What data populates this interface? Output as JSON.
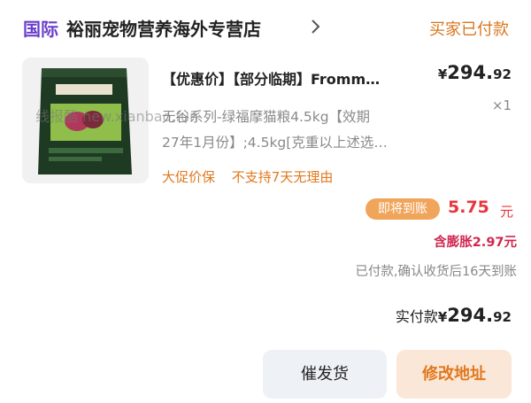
{
  "shop": {
    "tag": "国际",
    "name": "裕丽宠物营养海外专营店",
    "chevron_icon": "chevron-right-icon"
  },
  "order": {
    "status": "买家已付款"
  },
  "product": {
    "thumbnail_icon": "cat-food-bag-image",
    "title": "【优惠价】【部分临期】Fromm…",
    "spec_line1": "无谷系列-绿福摩猫粮4.5kg【效期",
    "spec_line2": "27年1月份】;4.5kg[克重以上述选…",
    "promo1": "大促价保",
    "promo2": "不支持7天无理由",
    "price_currency": "¥",
    "price_int": "294.",
    "price_dec": "92",
    "quantity": "×1"
  },
  "settlement": {
    "badge": "即将到账",
    "amount": "5.75",
    "unit": "元",
    "bloat": "含膨胀2.97元",
    "note": "已付款,确认收货后16天到账"
  },
  "total": {
    "label": "实付款",
    "currency": "¥",
    "int": "294.",
    "dec": "92"
  },
  "actions": {
    "urge": "催发货",
    "modify_address": "修改地址"
  },
  "watermark": "线报酷 new.xianbao.fun"
}
